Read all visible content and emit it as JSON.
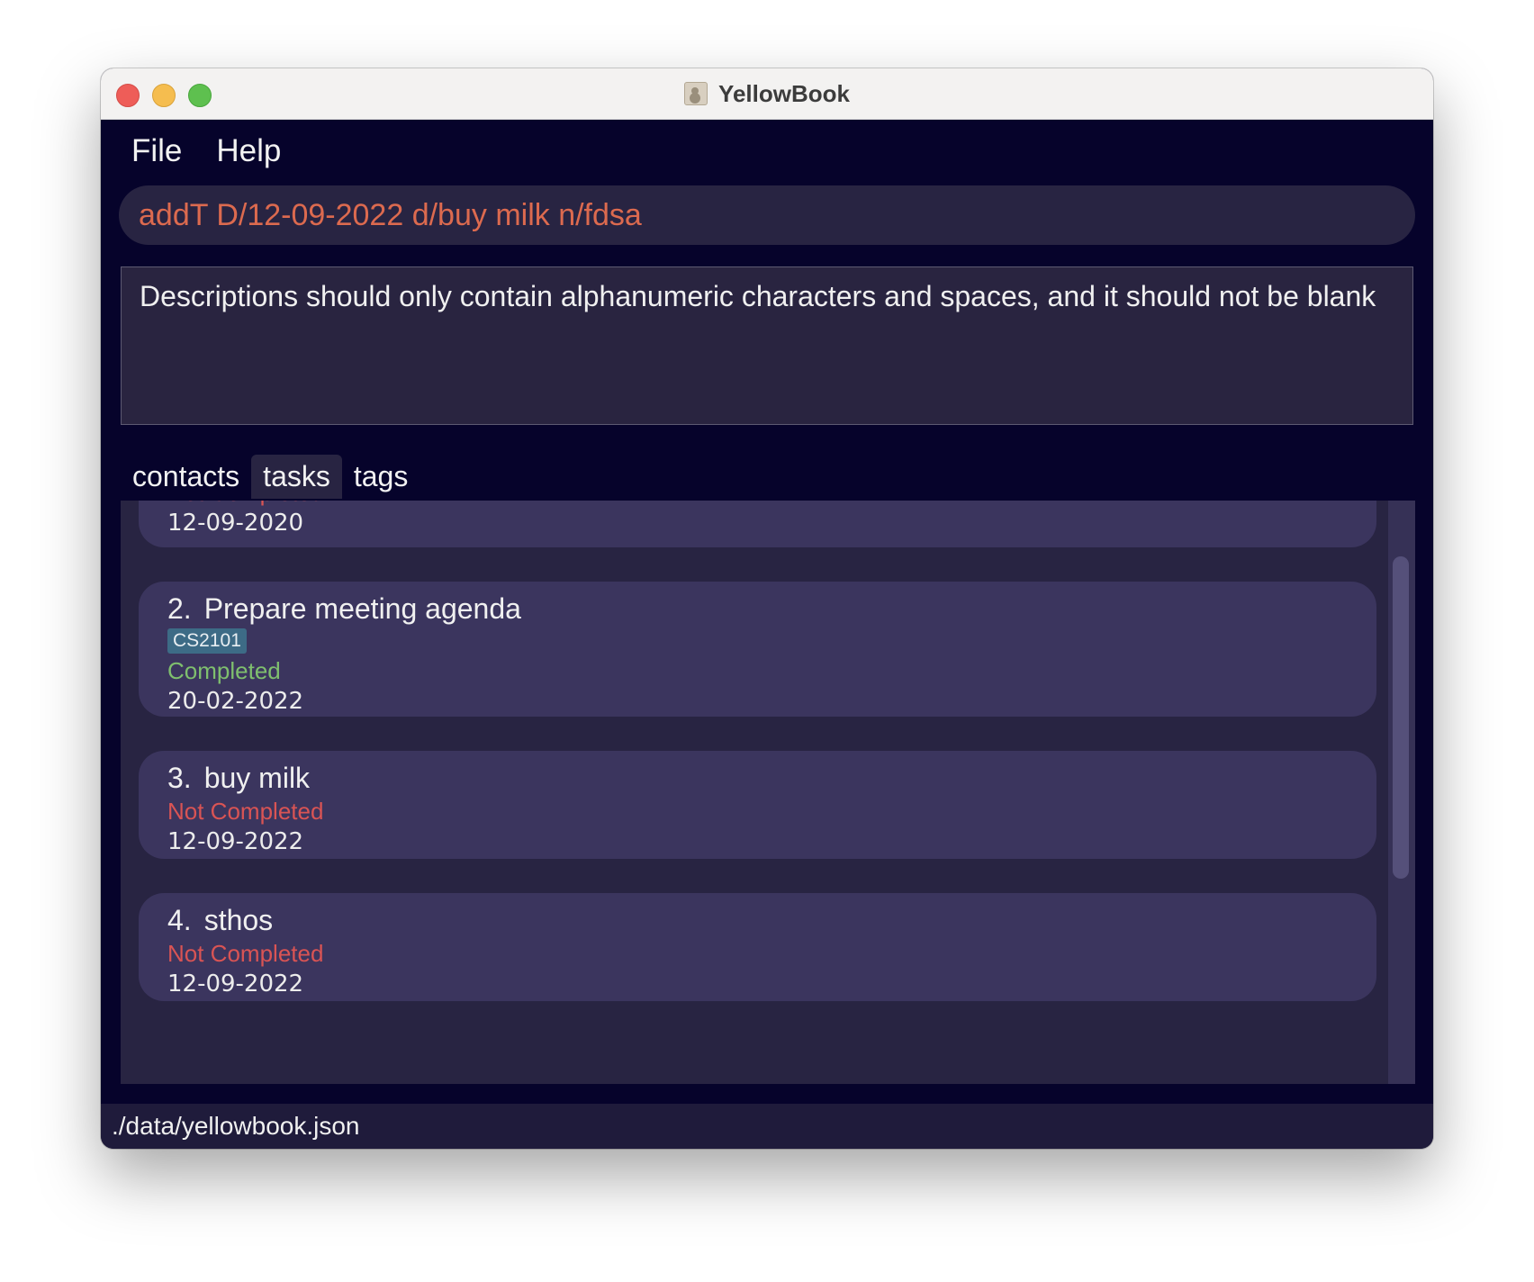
{
  "window": {
    "title": "YellowBook",
    "app_icon": "address-book-icon"
  },
  "menu": {
    "file": "File",
    "help": "Help"
  },
  "command": {
    "value": "addT D/12-09-2022 d/buy milk n/fdsa"
  },
  "result": {
    "message": "Descriptions should only contain alphanumeric characters and spaces, and it should not be blank"
  },
  "tabs": [
    {
      "label": "contacts",
      "active": false
    },
    {
      "label": "tasks",
      "active": true
    },
    {
      "label": "tags",
      "active": false
    }
  ],
  "tasks": [
    {
      "index": "",
      "title": "",
      "status": "Not Completed",
      "date": "12-09-2020"
    },
    {
      "index": "2.",
      "title": "Prepare meeting agenda",
      "tag": "CS2101",
      "status": "Completed",
      "date": "20-02-2022"
    },
    {
      "index": "3.",
      "title": "buy milk",
      "status": "Not Completed",
      "date": "12-09-2022"
    },
    {
      "index": "4.",
      "title": "sthos",
      "status": "Not Completed",
      "date": "12-09-2022"
    }
  ],
  "statusbar": {
    "path": "./data/yellowbook.json"
  },
  "colors": {
    "background": "#06032b",
    "panel": "#282442",
    "card": "#3b355e",
    "command_text": "#dc6a4f",
    "not_completed": "#d95454",
    "completed": "#7fbf6e",
    "tag": "#3d6b86"
  }
}
